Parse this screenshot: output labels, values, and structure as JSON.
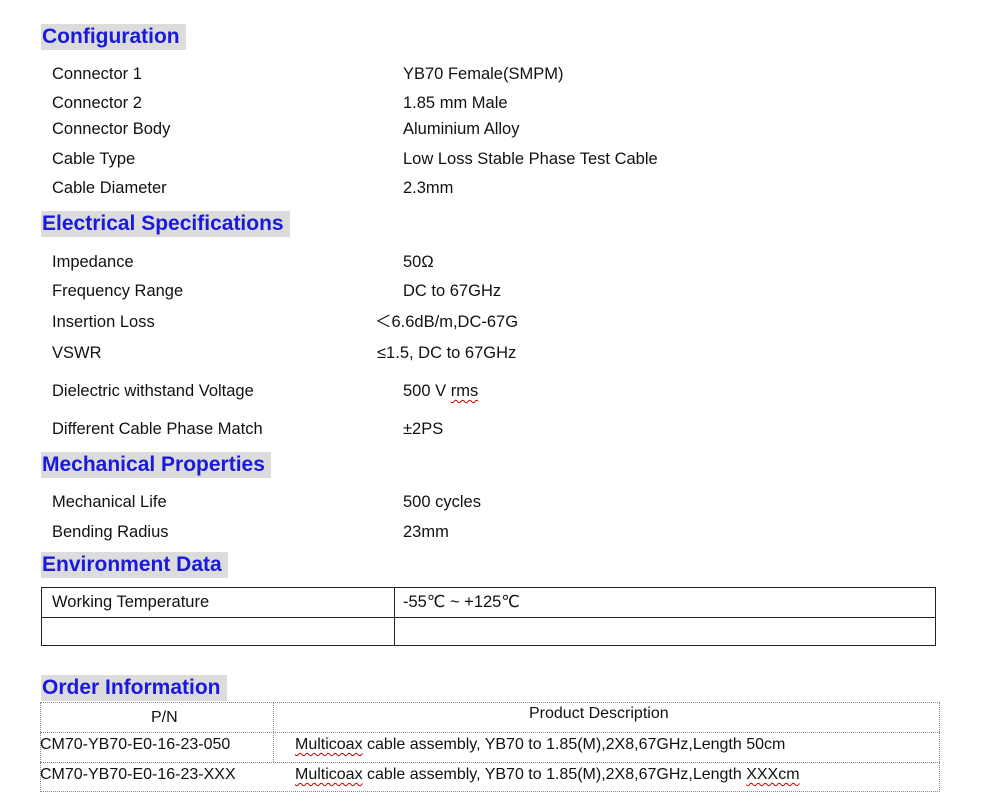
{
  "configuration": {
    "heading": "Configuration",
    "rows": [
      {
        "label": "Connector 1",
        "value": "YB70 Female(SMPM)"
      },
      {
        "label": "Connector 2",
        "value": "1.85 mm Male"
      },
      {
        "label": "Connector Body",
        "value": "Aluminium Alloy"
      },
      {
        "label": "Cable Type",
        "value": "Low Loss Stable Phase Test Cable"
      },
      {
        "label": "Cable Diameter",
        "value": "2.3mm"
      }
    ]
  },
  "electrical": {
    "heading": "Electrical Specifications",
    "rows": [
      {
        "label": "Impedance",
        "value": "50Ω"
      },
      {
        "label": "Frequency Range",
        "value": "DC to 67GHz"
      },
      {
        "label": "Insertion Loss",
        "value": "＜6.6dB/m,DC-67G"
      },
      {
        "label": "VSWR",
        "value": "≤1.5, DC to 67GHz"
      },
      {
        "label": "Dielectric withstand Voltage",
        "value_main": "500 V ",
        "value_unit": "rms"
      },
      {
        "label": "Different Cable Phase Match",
        "value": "±2PS"
      }
    ]
  },
  "mechanical": {
    "heading": "Mechanical Properties",
    "rows": [
      {
        "label": "Mechanical Life",
        "value": "500 cycles"
      },
      {
        "label": "Bending Radius",
        "value": "23mm"
      }
    ]
  },
  "environment": {
    "heading": "Environment Data",
    "rows": [
      {
        "label": "Working Temperature",
        "value": "-55℃  ~ +125℃"
      },
      {
        "label": "",
        "value": ""
      }
    ]
  },
  "order": {
    "heading": "Order Information",
    "columns": [
      "P/N",
      "Product Description"
    ],
    "rows": [
      {
        "pn": "CM70-YB70-E0-16-23-050",
        "desc_word": "Multicoax",
        "desc_rest": " cable assembly, YB70 to 1.85(M),2X8,67GHz,Length 50cm",
        "desc_tail": ""
      },
      {
        "pn": "CM70-YB70-E0-16-23-XXX",
        "desc_word": "Multicoax",
        "desc_rest": " cable assembly,  YB70 to 1.85(M),2X8,67GHz,Length ",
        "desc_tail": "XXXcm"
      }
    ]
  }
}
